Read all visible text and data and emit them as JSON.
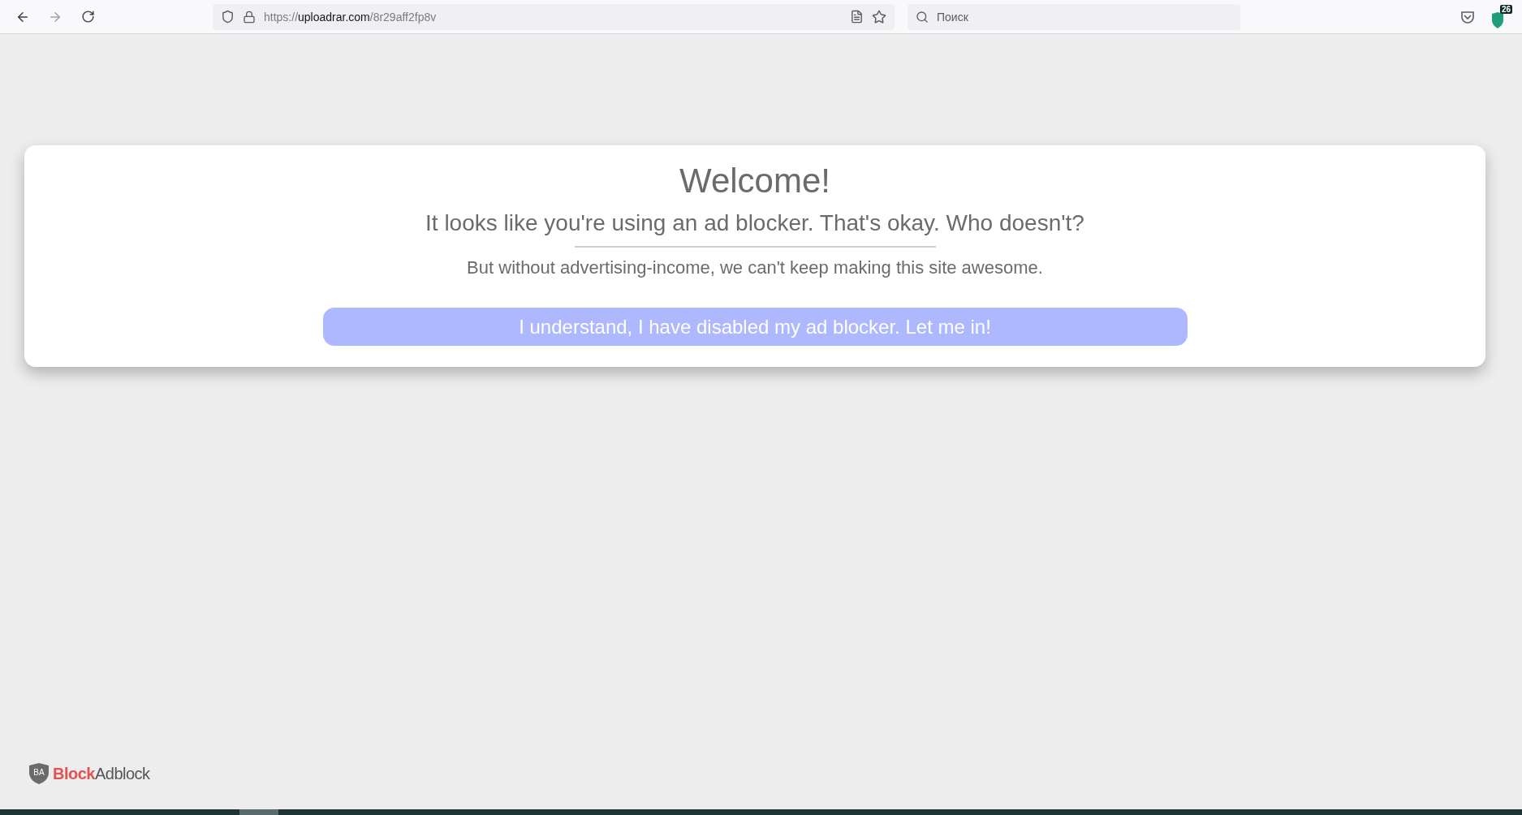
{
  "browser": {
    "url": {
      "scheme": "https://",
      "host": "uploadrar.com",
      "path": "/8r29aff2fp8v"
    },
    "search": {
      "placeholder": "Поиск"
    },
    "extension_badge": "26"
  },
  "dialog": {
    "title": "Welcome!",
    "subtitle": "It looks like you're using an ad blocker. That's okay. Who doesn't?",
    "message": "But without advertising-income, we can't keep making this site awesome.",
    "button": "I understand, I have disabled my ad blocker. Let me in!"
  },
  "brand": {
    "monogram": "BA",
    "name": "**Block**Adblock"
  }
}
